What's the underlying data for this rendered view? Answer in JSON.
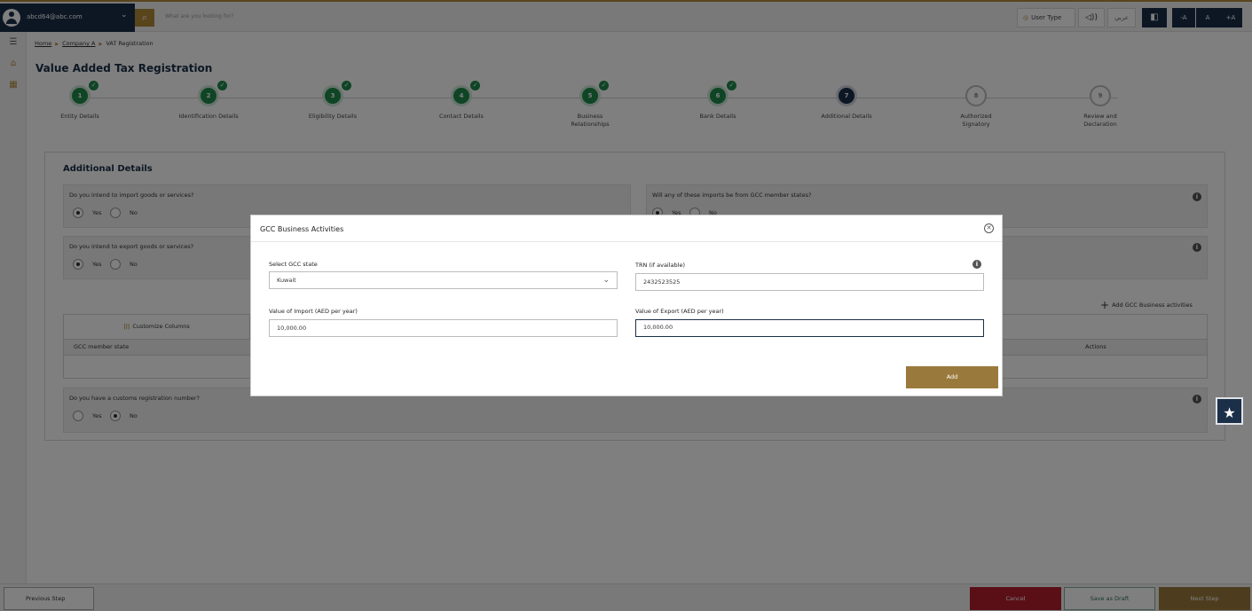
{
  "header": {
    "user_email": "abcd64@abc.com",
    "search_placeholder": "What are you looking for?",
    "user_type": "User Type",
    "arabic": "عربي",
    "font_decrease": "-A",
    "font_normal": "A",
    "font_increase": "+A"
  },
  "breadcrumb": [
    "Home",
    "Company A",
    "VAT Registration"
  ],
  "page_title": "Value Added Tax Registration",
  "steps": [
    {
      "num": "1",
      "label": "Entity Details",
      "status": "done"
    },
    {
      "num": "2",
      "label": "Identification Details",
      "status": "done"
    },
    {
      "num": "3",
      "label": "Eligibility Details",
      "status": "done"
    },
    {
      "num": "4",
      "label": "Contact Details",
      "status": "done"
    },
    {
      "num": "5",
      "label": "Business Relationships",
      "status": "done"
    },
    {
      "num": "6",
      "label": "Bank Details",
      "status": "done"
    },
    {
      "num": "7",
      "label": "Additional Details",
      "status": "active"
    },
    {
      "num": "8",
      "label": "Authorized Signatory",
      "status": "todo"
    },
    {
      "num": "9",
      "label": "Review and Declaration",
      "status": "todo"
    }
  ],
  "section": {
    "title": "Additional Details",
    "q_import": "Do you intend to import goods or services?",
    "q_gcc_imports": "Will any of these imports be from GCC member states?",
    "q_export": "Do you intend to export goods or services?",
    "q_customs": "Do you have a customs registration number?",
    "yes": "Yes",
    "no": "No",
    "add_gcc": "Add GCC Business activities",
    "customize_columns": "Customize Columns",
    "col_gcc_state": "GCC member state",
    "col_actions": "Actions"
  },
  "modal": {
    "title": "GCC Business Activities",
    "select_label": "Select GCC state",
    "select_value": "Kuwait",
    "trn_label": "TRN (if available)",
    "trn_value": "2432523525",
    "import_label": "Value of Import (AED per year)",
    "import_value": "10,000.00",
    "export_label": "Value of Export (AED per year)",
    "export_value": "10,000.00",
    "add_button": "Add"
  },
  "footer": {
    "prev": "Previous Step",
    "cancel": "Cancel",
    "save_draft": "Save as Draft",
    "next": "Next Step"
  },
  "colors": {
    "navy": "#1b2f48",
    "gold": "#b28a38",
    "green": "#1e8a4a",
    "red": "#b51f2e"
  }
}
